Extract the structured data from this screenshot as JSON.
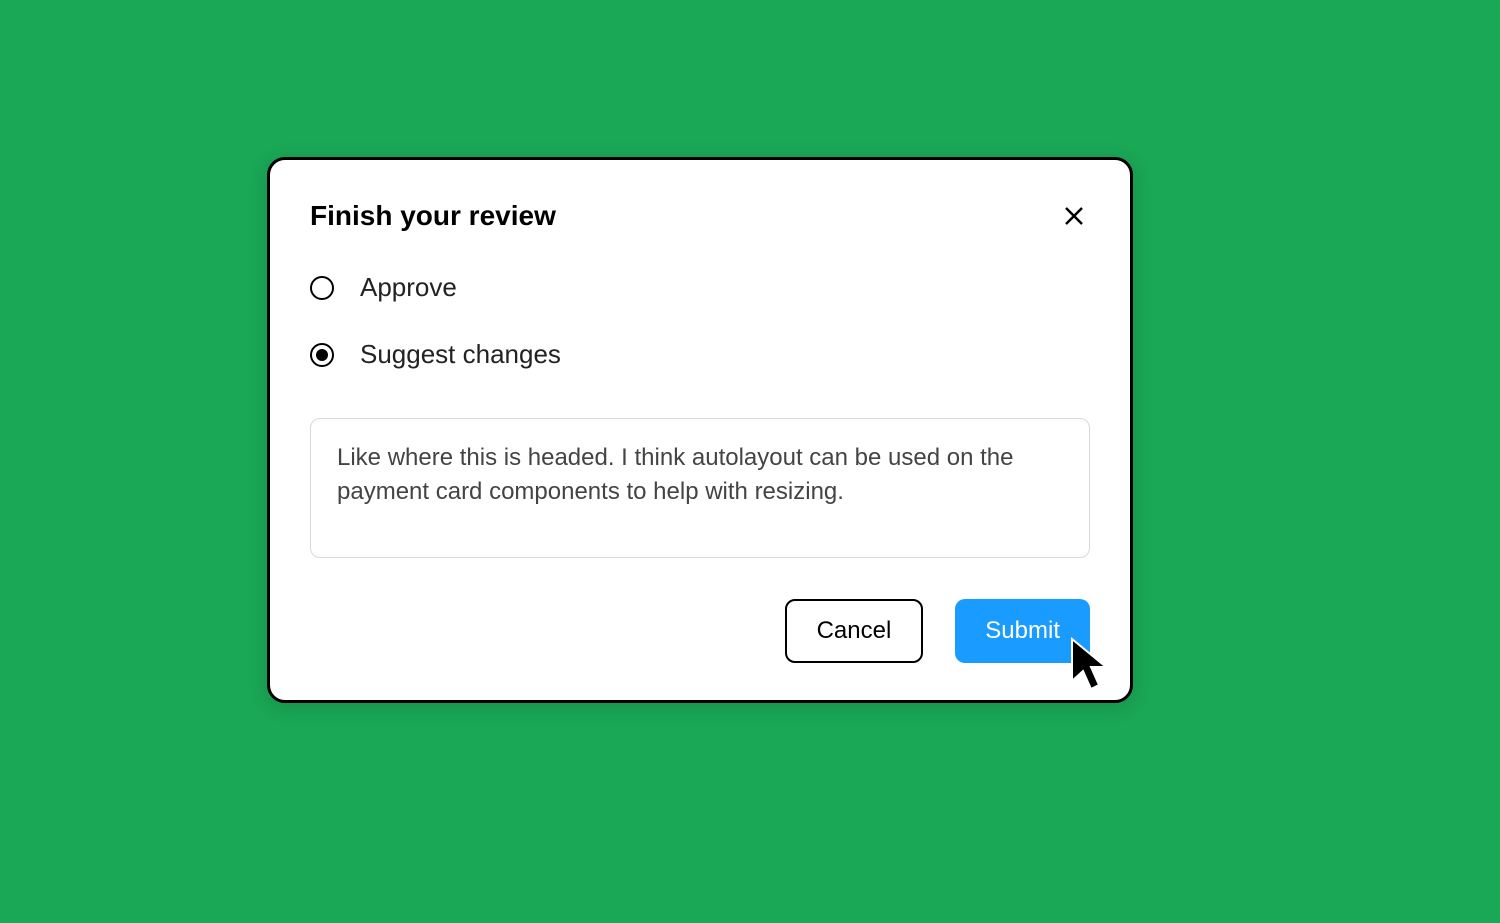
{
  "dialog": {
    "title": "Finish your review",
    "options": {
      "approve": {
        "label": "Approve",
        "selected": false
      },
      "suggest": {
        "label": "Suggest changes",
        "selected": true
      }
    },
    "comment": "Like where this is headed. I think autolayout can be used on the payment card components to help with resizing.",
    "buttons": {
      "cancel": "Cancel",
      "submit": "Submit"
    }
  },
  "colors": {
    "background": "#1aa756",
    "primary_button": "#1a9bff"
  }
}
